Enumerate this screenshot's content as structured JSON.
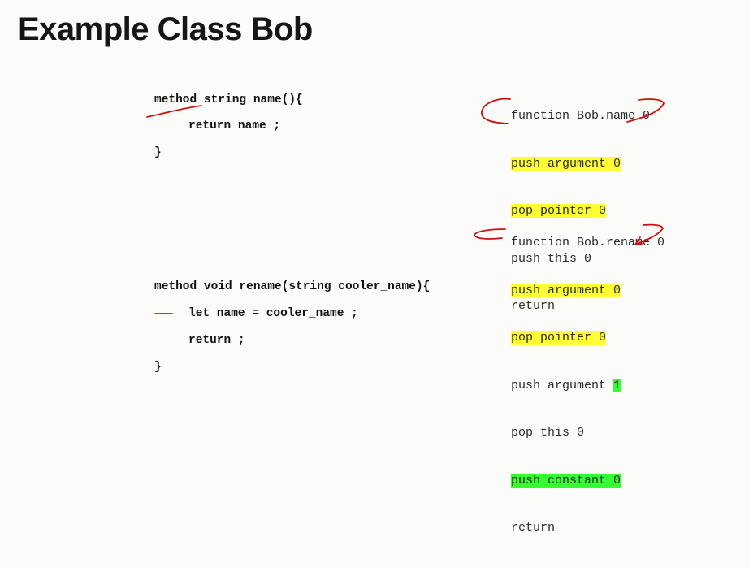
{
  "slide": {
    "title": "Example Class Bob"
  },
  "method1": {
    "lines": [
      "method string name(){",
      "return name ;",
      "}"
    ]
  },
  "method2": {
    "lines": [
      "method void rename(string cooler_name){",
      "let name = cooler_name ;",
      "return ;",
      "}"
    ]
  },
  "vm1": {
    "lines": [
      {
        "text": "function Bob.name 0"
      },
      {
        "text": "push argument 0",
        "highlight": "yellow"
      },
      {
        "text": "pop pointer 0",
        "highlight": "yellow"
      },
      {
        "text": "push this 0"
      },
      {
        "text": "return"
      }
    ]
  },
  "vm2": {
    "line0": "function Bob.rename 0",
    "line1": "push argument 0",
    "line2": "pop pointer 0",
    "line3_prefix": "push argument ",
    "line3_arg": "1",
    "line4": "pop this 0",
    "line5": "push constant 0",
    "line6": "return"
  },
  "colors": {
    "highlight_yellow": "#ffff33",
    "highlight_green": "#33ff33",
    "ink_red": "#cc1111"
  }
}
